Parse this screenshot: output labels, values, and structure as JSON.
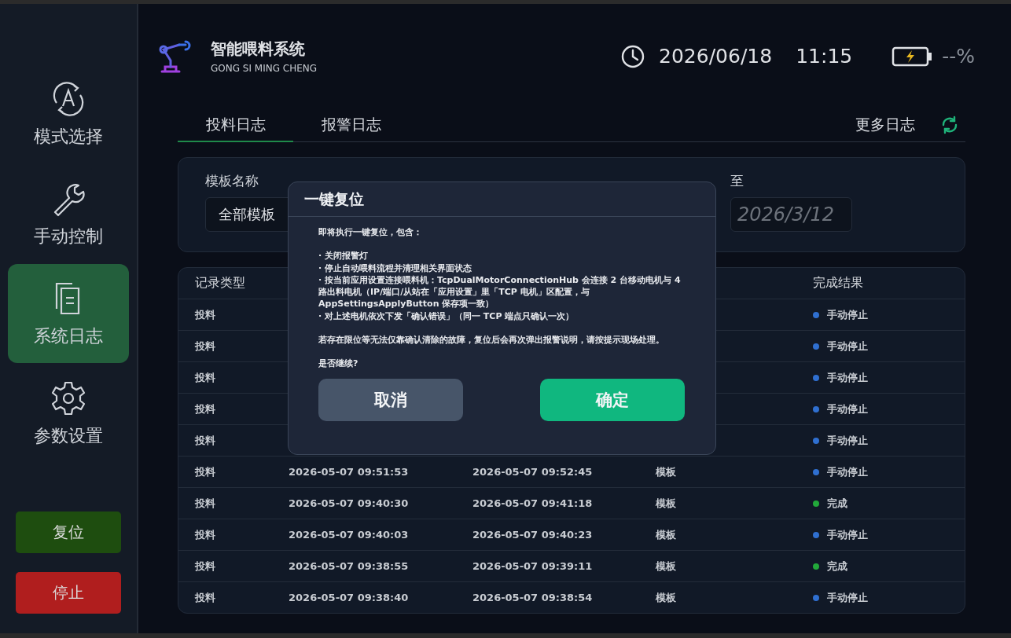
{
  "header": {
    "title": "智能喂料系统",
    "subtitle": "GONG SI MING CHENG",
    "date": "2026/06/18",
    "time": "11:15",
    "battery": "--%"
  },
  "sidebar": {
    "items": [
      {
        "kind": "mode",
        "label": "模式选择",
        "selected": false
      },
      {
        "kind": "manual",
        "label": "手动控制",
        "selected": false
      },
      {
        "kind": "log",
        "label": "系统日志",
        "selected": true
      },
      {
        "kind": "settings",
        "label": "参数设置",
        "selected": false
      }
    ],
    "buttons": [
      {
        "kind": "reset",
        "label": "复位"
      },
      {
        "kind": "stop",
        "label": "停止"
      }
    ]
  },
  "tabs": [
    {
      "label": "投料日志",
      "selected": true
    },
    {
      "label": "报警日志",
      "selected": false
    }
  ],
  "more_logs": "更多日志",
  "filters": {
    "template_label": "模板名称",
    "template_value": "全部模板",
    "to_label": "至",
    "to_placeholder": "2026/3/12"
  },
  "table": {
    "columns": {
      "column_1": "记录类型",
      "column_5": "完成结果"
    },
    "rows": [
      {
        "type": "投料",
        "result": "手动停止",
        "color": "#2f6fd0"
      },
      {
        "type": "投料",
        "result": "手动停止",
        "color": "#2f6fd0"
      },
      {
        "type": "投料",
        "result": "手动停止",
        "color": "#2f6fd0"
      },
      {
        "type": "投料",
        "result": "手动停止",
        "color": "#2f6fd0"
      },
      {
        "type": "投料",
        "result": "手动停止",
        "color": "#2f6fd0"
      },
      {
        "type": "投料",
        "start": "2026-05-07 09:51:53",
        "end": "2026-05-07 09:52:45",
        "template": "模板",
        "result": "手动停止",
        "color": "#2f6fd0"
      },
      {
        "type": "投料",
        "start": "2026-05-07 09:40:30",
        "end": "2026-05-07 09:41:18",
        "template": "模板",
        "result": "完成",
        "color": "#22a83a"
      },
      {
        "type": "投料",
        "start": "2026-05-07 09:40:03",
        "end": "2026-05-07 09:40:23",
        "template": "模板",
        "result": "手动停止",
        "color": "#2f6fd0"
      },
      {
        "type": "投料",
        "start": "2026-05-07 09:38:55",
        "end": "2026-05-07 09:39:11",
        "template": "模板",
        "result": "完成",
        "color": "#22a83a"
      },
      {
        "type": "投料",
        "start": "2026-05-07 09:38:40",
        "end": "2026-05-07 09:38:54",
        "template": "模板",
        "result": "手动停止",
        "color": "#2f6fd0"
      }
    ]
  },
  "dialog": {
    "title": "一键复位",
    "intro": "即将执行一键复位，包含：",
    "bullets": [
      "· 关闭报警灯",
      "· 停止自动喂料流程并清理相关界面状态",
      "· 按当前应用设置连接喂料机：TcpDualMotorConnectionHub 会连接 2 台移动电机与 4 路出料电机（IP/端口/从站在「应用设置」里「TCP 电机」区配置，与 AppSettingsApplyButton 保存项一致）",
      "· 对上述电机依次下发「确认错误」（同一 TCP 端点只确认一次）"
    ],
    "note": "若存在限位等无法仅靠确认清除的故障，复位后会再次弹出报警说明，请按提示现场处理。",
    "question": "是否继续?",
    "cancel": "取消",
    "confirm": "确定"
  }
}
